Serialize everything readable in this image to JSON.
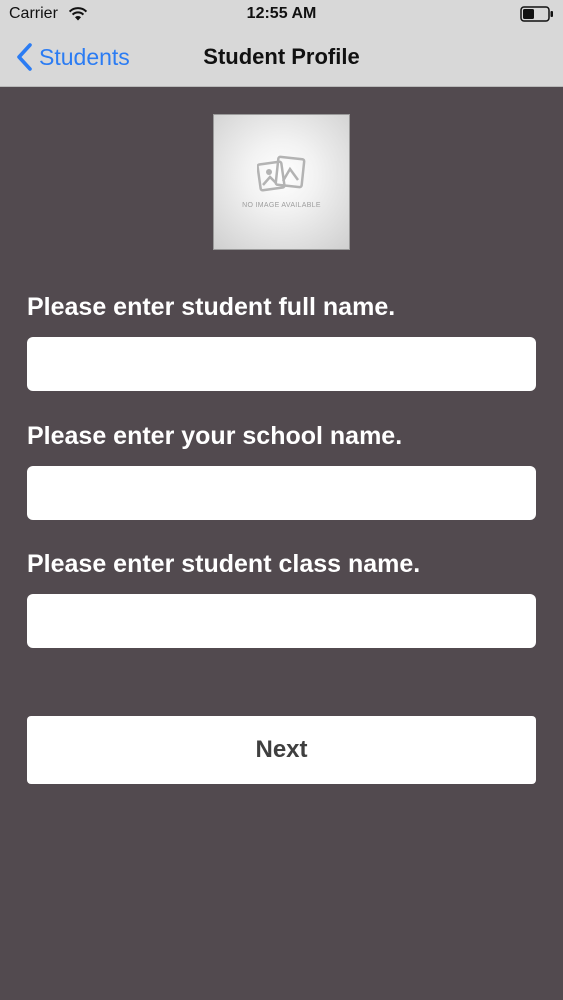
{
  "status_bar": {
    "carrier": "Carrier",
    "time": "12:55 AM",
    "icons": [
      "wifi-icon",
      "battery-icon"
    ]
  },
  "nav": {
    "back_label": "Students",
    "title": "Student Profile",
    "accent_color": "#2b7cf3"
  },
  "photo": {
    "caption": "NO IMAGE AVAILABLE",
    "icon": "image-placeholder-icon"
  },
  "form": {
    "full_name": {
      "label": "Please enter student full name.",
      "value": "",
      "placeholder": ""
    },
    "school_name": {
      "label": "Please enter your school name.",
      "value": "",
      "placeholder": ""
    },
    "class_name": {
      "label": "Please enter student class name.",
      "value": "",
      "placeholder": ""
    }
  },
  "next_button": {
    "label": "Next"
  },
  "colors": {
    "background": "#524a4f",
    "nav_background": "#d8d8d8",
    "label_text": "#ffffff"
  }
}
